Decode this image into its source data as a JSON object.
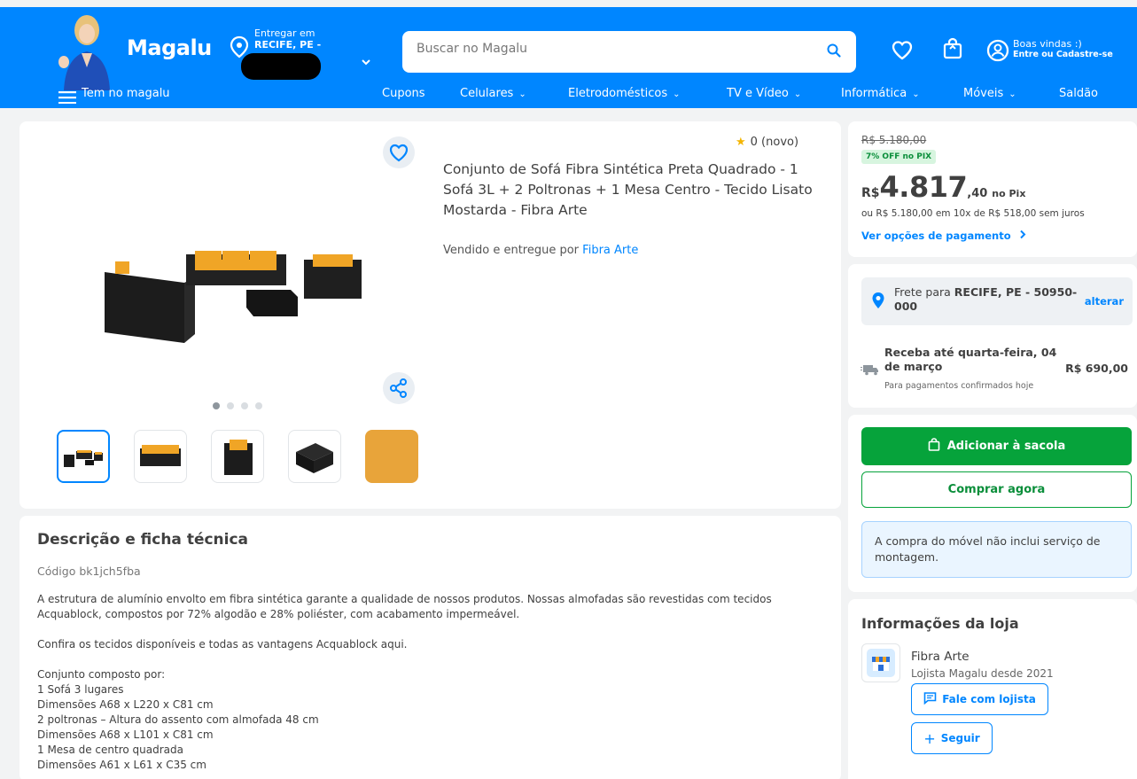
{
  "header": {
    "logo": "Magalu",
    "location_label": "Entregar em",
    "location_city": "RECIFE, PE -",
    "search_placeholder": "Buscar no Magalu",
    "welcome": "Boas vindas :)",
    "login": "Entre ou Cadastre-se"
  },
  "nav": {
    "menu": "Tem no magalu",
    "items": [
      "Cupons",
      "Celulares",
      "Eletrodomésticos",
      "TV e Vídeo",
      "Informática",
      "Móveis",
      "Saldão"
    ]
  },
  "product": {
    "rating": "0 (novo)",
    "title": "Conjunto de Sofá Fibra Sintética Preta Quadrado - 1 Sofá 3L + 2 Poltronas + 1 Mesa Centro - Tecido Lisato Mostarda - Fibra Arte",
    "seller_prefix": "Vendido e entregue por",
    "seller_name": "Fibra Arte",
    "image_count": 4,
    "active_image": 1
  },
  "price": {
    "old": "R$ 5.180,00",
    "discount_badge": "7% OFF no PIX",
    "currency": "R$",
    "integer": "4.817",
    "decimal": ",40",
    "pix_label": "no Pix",
    "installment": "ou R$ 5.180,00 em 10x de R$ 518,00 sem juros",
    "payment_link": "Ver opções de pagamento"
  },
  "shipping": {
    "freight_label": "Frete para",
    "freight_city": "RECIFE, PE - 50950-000",
    "change": "alterar",
    "delivery": "Receba até quarta-feira, 04 de março",
    "price": "R$ 690,00",
    "note": "Para pagamentos confirmados hoje"
  },
  "actions": {
    "add_to_bag": "Adicionar à sacola",
    "buy_now": "Comprar agora",
    "notice": "A compra do móvel não inclui serviço de montagem."
  },
  "store": {
    "title": "Informações da loja",
    "name": "Fibra Arte",
    "since": "Lojista Magalu desde 2021",
    "chat": "Fale com lojista",
    "follow": "Seguir"
  },
  "description": {
    "title": "Descrição e ficha técnica",
    "code": "Código bk1jch5fba",
    "para1": "A estrutura de alumínio envolto em fibra sintética garante a qualidade de nossos produtos. Nossas almofadas são revestidas com tecidos Acquablock, compostos por 72% algodão e 28% poliéster, com acabamento impermeável.",
    "para2": "Confira os tecidos disponíveis e todas as vantagens Acquablock aqui.",
    "lines": [
      "Conjunto composto por:",
      "1 Sofá 3 lugares",
      "Dimensões A68 x L220 x C81 cm",
      "2 poltronas – Altura do assento com almofada 48 cm",
      "Dimensões A68 x L101 x C81 cm",
      "1 Mesa de centro quadrada",
      "Dimensões A61 x L61 x C35 cm"
    ]
  },
  "colors": {
    "brand": "#0086ff",
    "buy": "#06a33b",
    "cushion": "#f0a526"
  }
}
